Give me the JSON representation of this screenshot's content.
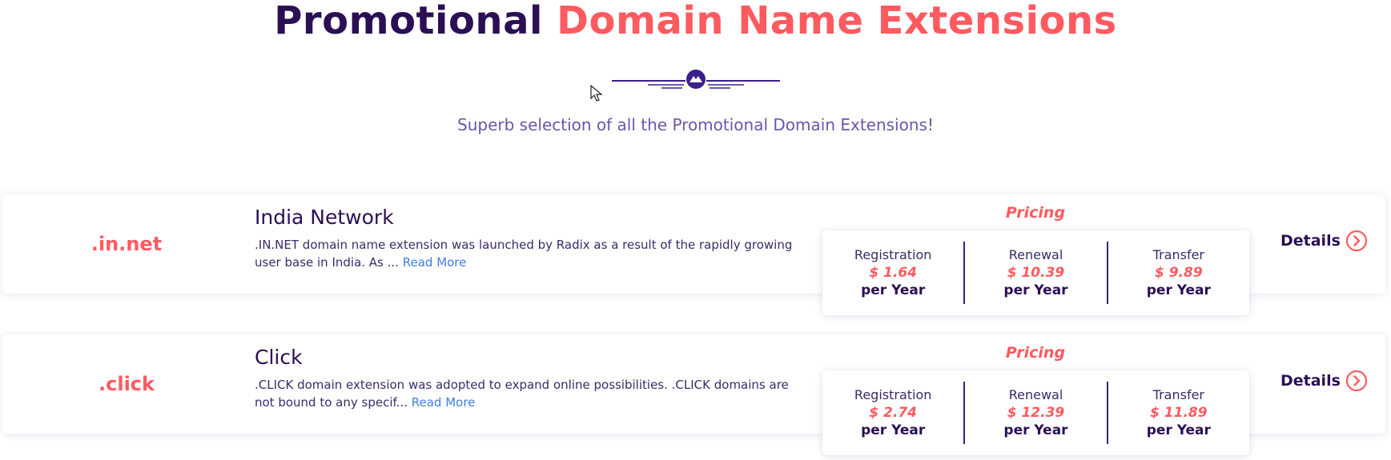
{
  "header": {
    "title_main": "Promotional",
    "title_accent": "Domain Name Extensions",
    "subtitle": "Superb selection of all the Promotional Domain Extensions!"
  },
  "colors": {
    "brand_dark": "#2b0f55",
    "accent": "#ff5a5f",
    "link": "#3d7de8"
  },
  "domains": [
    {
      "extension": ".in.net",
      "name": "India Network",
      "description": ".IN.NET domain name extension was launched by Radix as a result of the rapidly growing user base in India. As ...",
      "read_more": "Read More",
      "pricing_label": "Pricing",
      "registration_label": "Registration",
      "registration_price": "$ 1.64",
      "renewal_label": "Renewal",
      "renewal_price": "$ 10.39",
      "transfer_label": "Transfer",
      "transfer_price": "$ 9.89",
      "per_year": "per Year",
      "details_label": "Details",
      "details_icon": "chevron-right-circle-icon"
    },
    {
      "extension": ".click",
      "name": "Click",
      "description": ".CLICK domain extension was adopted to expand online possibilities. .CLICK domains are not bound to any specif...",
      "read_more": "Read More",
      "pricing_label": "Pricing",
      "registration_label": "Registration",
      "registration_price": "$ 2.74",
      "renewal_label": "Renewal",
      "renewal_price": "$ 12.39",
      "transfer_label": "Transfer",
      "transfer_price": "$ 11.89",
      "per_year": "per Year",
      "details_label": "Details",
      "details_icon": "chevron-right-circle-icon"
    }
  ]
}
